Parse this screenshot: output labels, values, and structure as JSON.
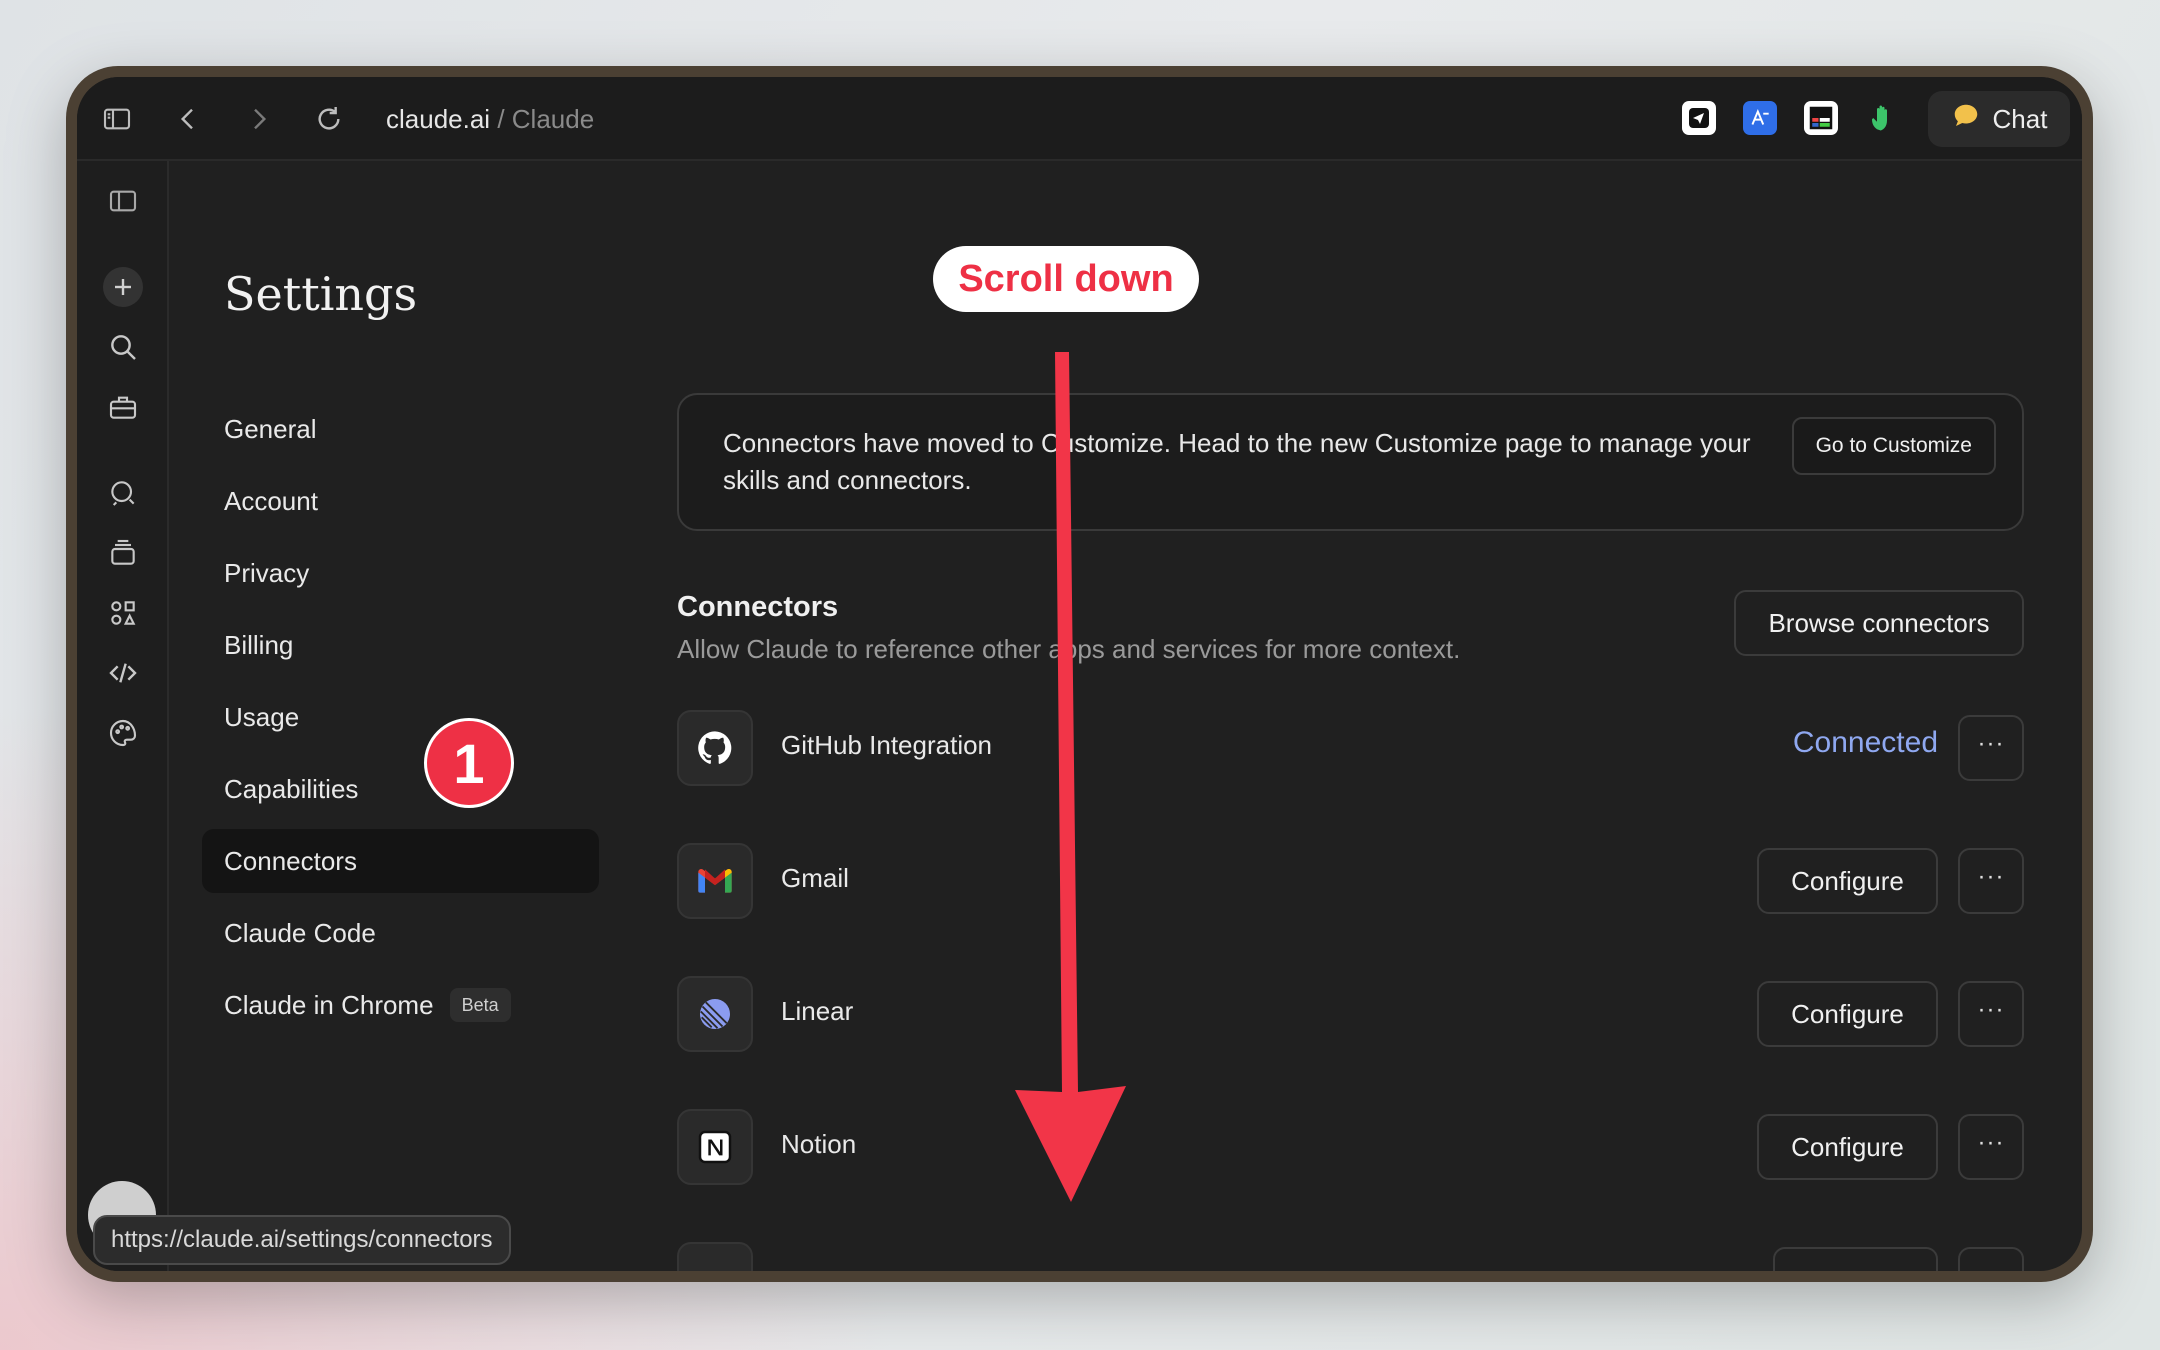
{
  "browser": {
    "url_domain": "claude.ai",
    "url_separator": "/",
    "url_site": "Claude",
    "chat_label": "Chat"
  },
  "settings": {
    "title": "Settings",
    "nav": [
      {
        "label": "General"
      },
      {
        "label": "Account"
      },
      {
        "label": "Privacy"
      },
      {
        "label": "Billing"
      },
      {
        "label": "Usage"
      },
      {
        "label": "Capabilities"
      },
      {
        "label": "Connectors",
        "active": true
      },
      {
        "label": "Claude Code"
      },
      {
        "label": "Claude in Chrome",
        "badge": "Beta"
      }
    ]
  },
  "notice": {
    "text": "Connectors have moved to Customize. Head to the new Customize page to manage your skills and connectors.",
    "button": "Go to Customize"
  },
  "connectors": {
    "title": "Connectors",
    "subtitle": "Allow Claude to reference other apps and services for more context.",
    "browse_label": "Browse connectors",
    "items": [
      {
        "name": "GitHub Integration",
        "status": "Connected",
        "icon": "github-icon"
      },
      {
        "name": "Gmail",
        "action": "Configure",
        "icon": "gmail-icon"
      },
      {
        "name": "Linear",
        "action": "Configure",
        "icon": "linear-icon"
      },
      {
        "name": "Notion",
        "action": "Configure",
        "icon": "notion-icon"
      }
    ],
    "more_label": "···"
  },
  "status_bar": {
    "url": "https://claude.ai/settings/connectors"
  },
  "annotation": {
    "pill_text": "Scroll down",
    "step_number": "1",
    "color": "#ee3045"
  }
}
